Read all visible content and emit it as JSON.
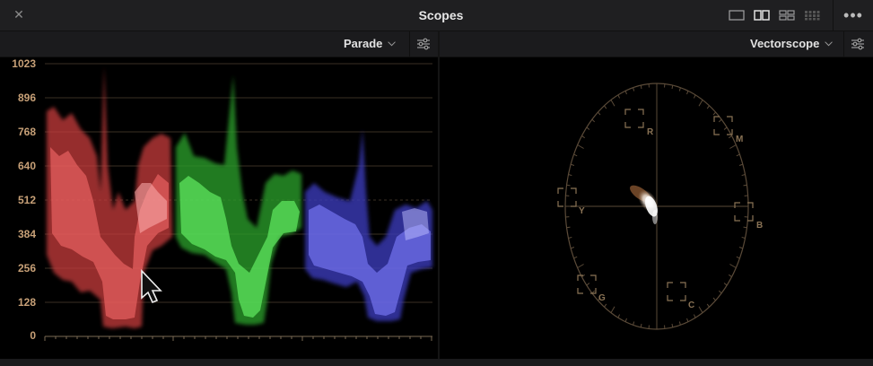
{
  "window": {
    "title": "Scopes",
    "close_icon": "close-icon",
    "more_icon": "more-horizontal-icon"
  },
  "layout_buttons": [
    {
      "name": "single-view",
      "icon": "layout-single-icon",
      "active": false
    },
    {
      "name": "dual-view",
      "icon": "layout-dual-icon",
      "active": true
    },
    {
      "name": "quad-view",
      "icon": "layout-quad-icon",
      "active": false
    },
    {
      "name": "grid-view",
      "icon": "layout-grid-icon",
      "active": false
    }
  ],
  "left_panel": {
    "scope_select": "Parade",
    "settings_icon": "sliders-icon",
    "y_axis_labels": [
      "1023",
      "896",
      "768",
      "640",
      "512",
      "384",
      "256",
      "128",
      "0"
    ]
  },
  "right_panel": {
    "scope_select": "Vectorscope",
    "settings_icon": "sliders-icon",
    "targets": [
      "R",
      "M",
      "B",
      "C",
      "G",
      "Y"
    ]
  },
  "colors": {
    "red_channel": "#ff5a5a",
    "green_channel": "#4dff4d",
    "blue_channel": "#6f6fff",
    "graticule": "#c7a077"
  }
}
